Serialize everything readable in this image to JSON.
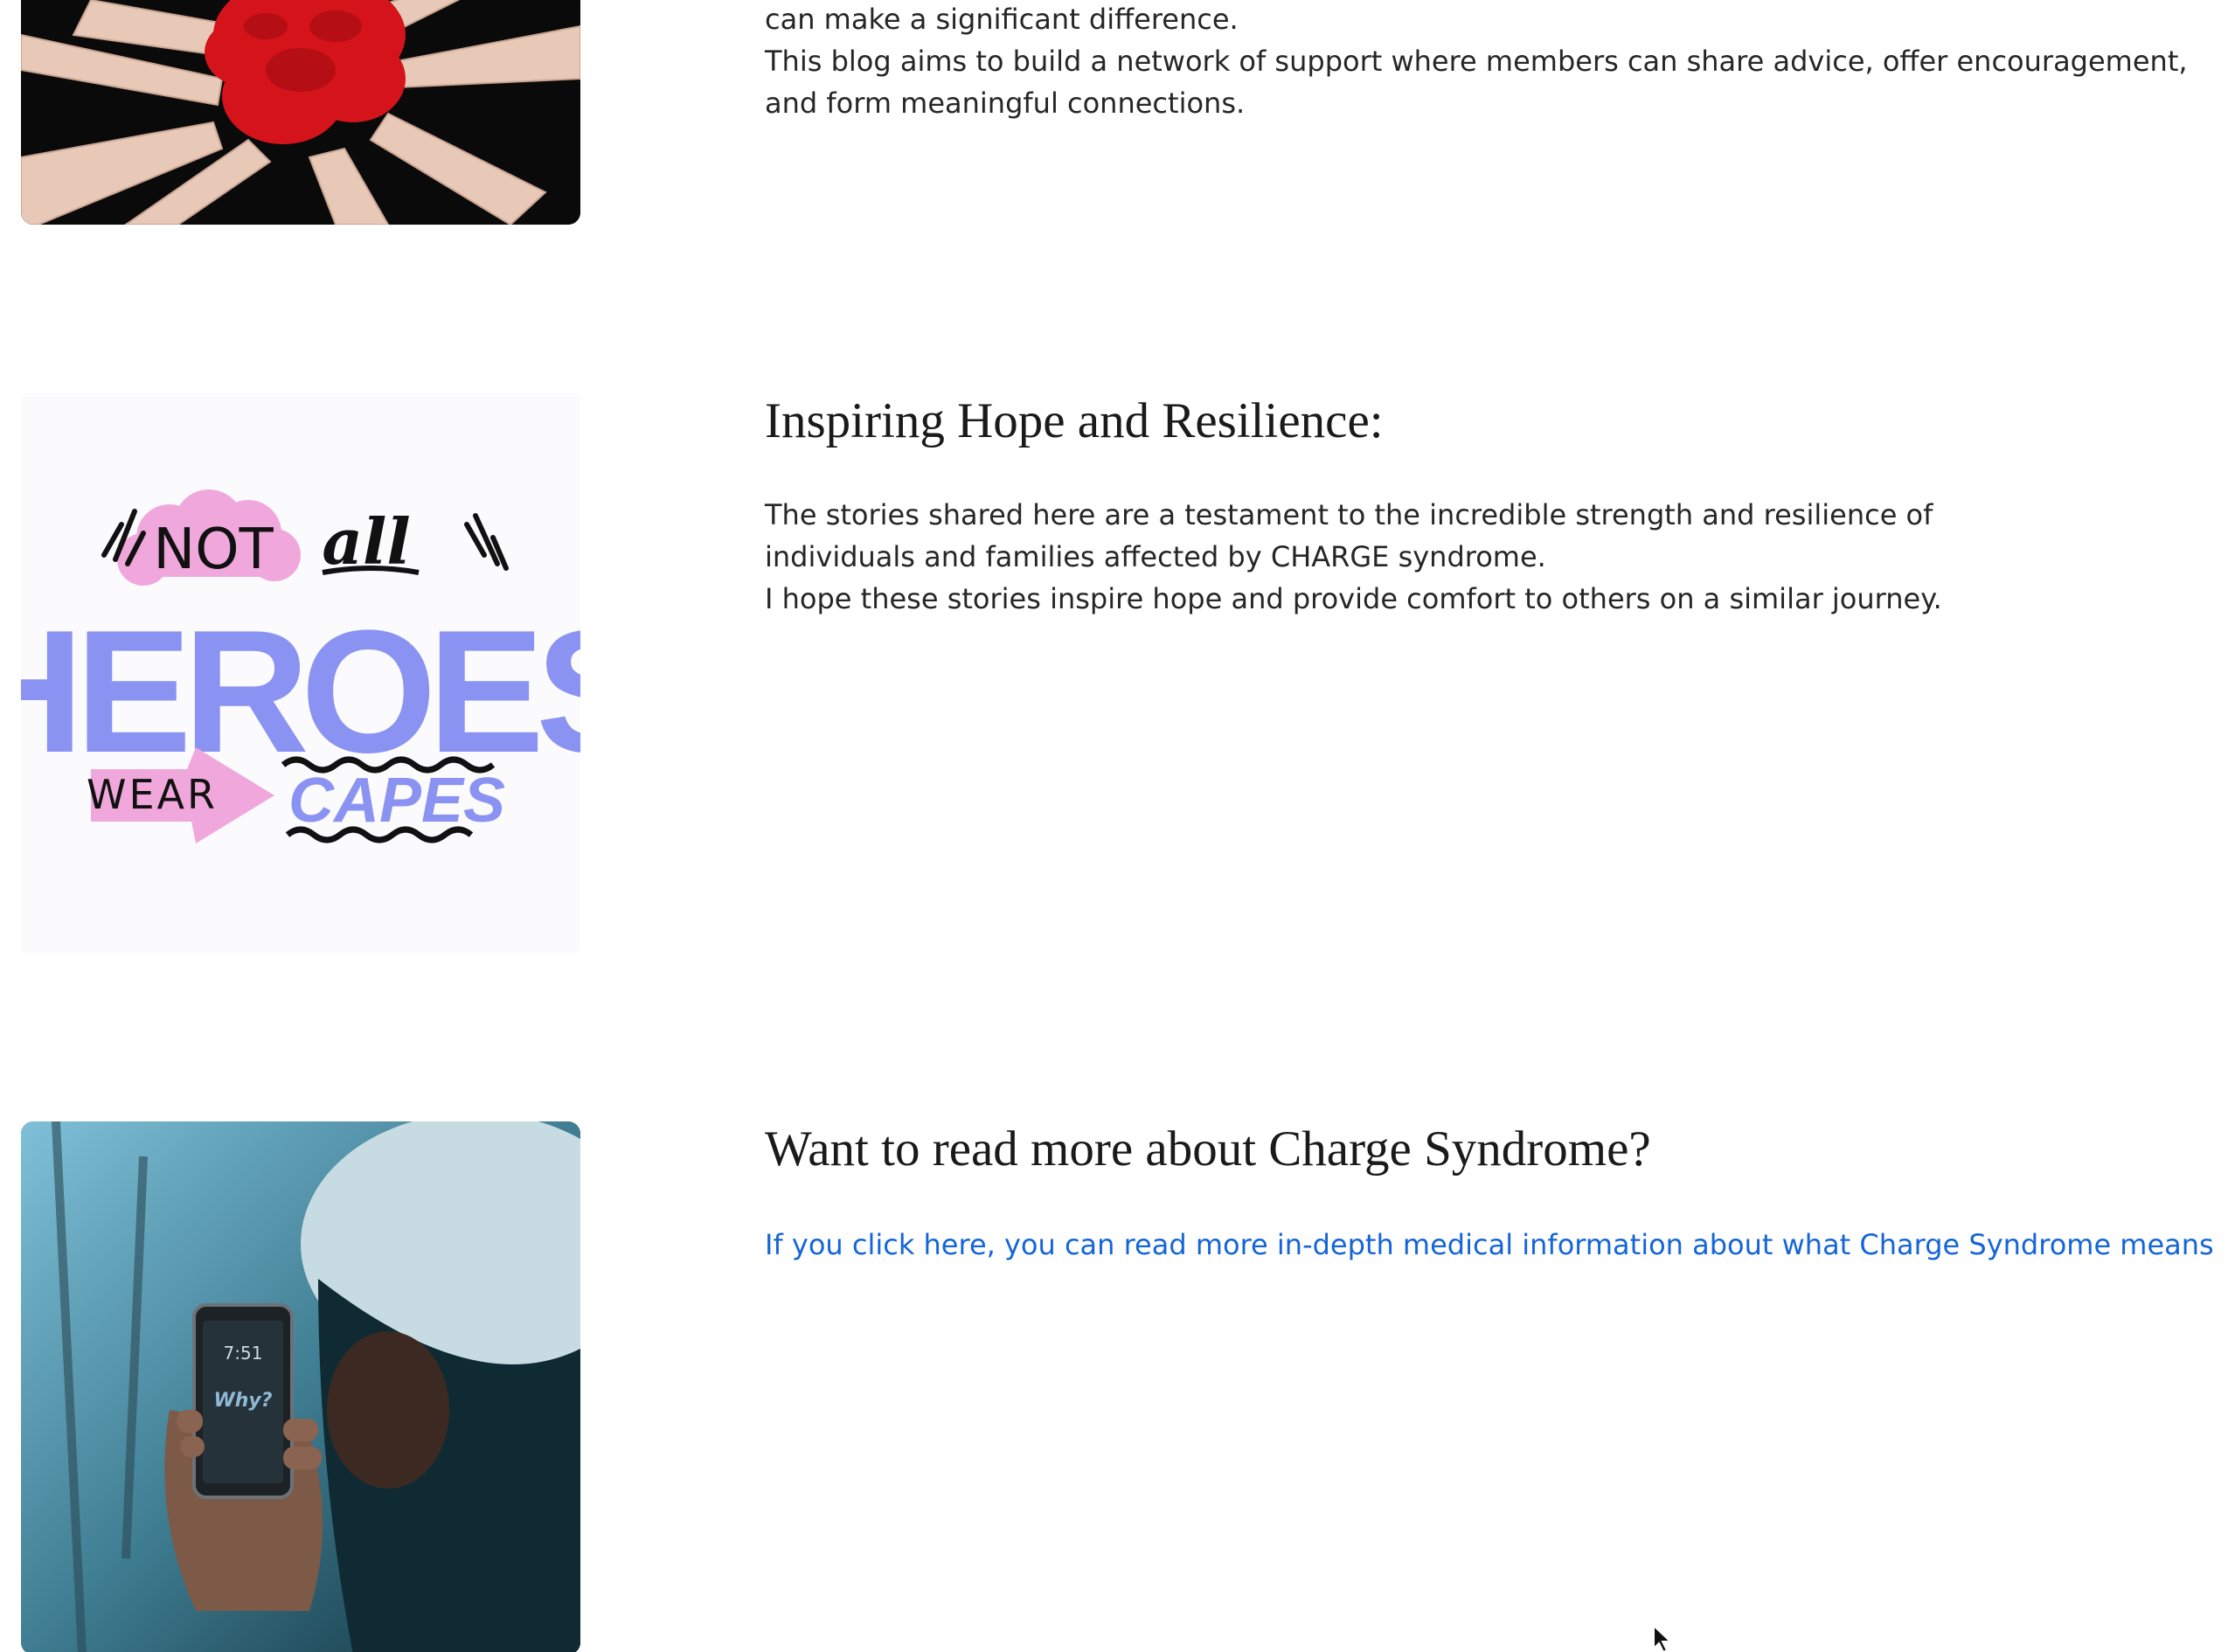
{
  "section1": {
    "paragraphs": [
      "can make a significant difference.",
      "This blog aims to build a network of support where members can share advice, offer encouragement,",
      "and form meaningful connections."
    ]
  },
  "section2": {
    "heading": "Inspiring Hope and Resilience:",
    "paragraphs": [
      "The stories shared here are a testament to the incredible strength and resilience of",
      "individuals and families affected by CHARGE syndrome.",
      "I hope these stories inspire hope and provide comfort to others on a similar journey."
    ],
    "image_text": {
      "not": "NOT",
      "all": "all",
      "heroes": "HEROES",
      "wear": "WEAR",
      "capes": "CAPES"
    }
  },
  "section3": {
    "heading": "Want to read more about Charge Syndrome?",
    "link": "If you click here, you can read more in-depth medical information about what Charge Syndrome means",
    "phone": {
      "time": "7:51",
      "screen_text": "Why?"
    }
  },
  "colors": {
    "link": "#1565d8",
    "heroes_blue": "#8b93f2",
    "heroes_pink": "#f0a8dc"
  }
}
